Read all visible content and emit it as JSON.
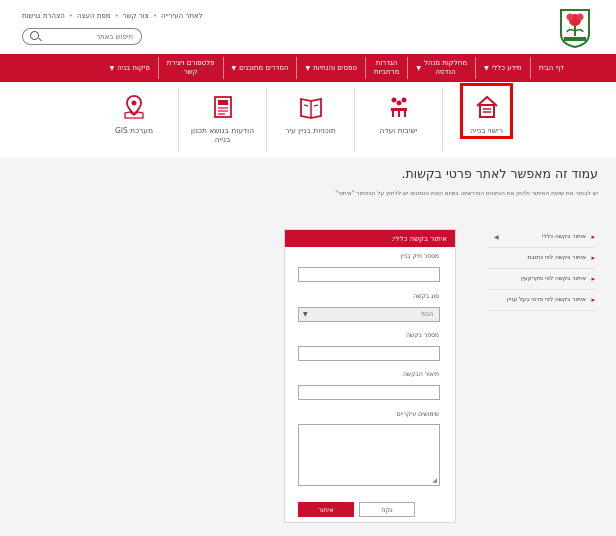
{
  "header": {
    "links": [
      "לאתר העירייה",
      "צור קשר",
      "מפת העצה",
      "הצהרת נגישות"
    ],
    "search_placeholder": "חיפוש באתר"
  },
  "nav": [
    {
      "label": "דף הבית",
      "caret": false
    },
    {
      "label": "מידע כללי",
      "caret": true
    },
    {
      "label": "מחלקות מנהל\nהנדסה",
      "caret": true
    },
    {
      "label": "הגדרות\nמרחביות",
      "caret": false
    },
    {
      "label": "טפסים והנחיות",
      "caret": true
    },
    {
      "label": "הסדרים מתוכנים",
      "caret": true
    },
    {
      "label": "פלטפורם ויצירת\nקשר",
      "caret": false
    },
    {
      "label": "פיקוח בניה",
      "caret": true
    }
  ],
  "icons": [
    {
      "label": "רישוי בנייה",
      "icon": "house-document-icon"
    },
    {
      "label": "ישיבות ועדה",
      "icon": "committee-people-icon"
    },
    {
      "label": "תוכניות בניין עיר",
      "icon": "map-book-icon"
    },
    {
      "label": "הודעות בנושא תכנון\nבנייה",
      "icon": "newspaper-icon"
    },
    {
      "label": "מערכת GIS",
      "icon": "map-pin-icon"
    }
  ],
  "page": {
    "title": "עמוד זה מאפשר לאתר פרטי בקשות.",
    "description": "יש לבחור את שיטת האיתור ולהזין את הנתונים הנדרשים. בסיום הזנת הנתונים יש ללחוץ על הכפתור \"איתור\""
  },
  "side_menu": [
    {
      "label": "איתור בקשה כללי",
      "arrow": true
    },
    {
      "label": "איתור בקשה לפי כתובת",
      "arrow": false
    },
    {
      "label": "איתור בקשה לפי מקרקעין",
      "arrow": false
    },
    {
      "label": "איתור בקשה לפי פרטי בעל עניין",
      "arrow": false
    }
  ],
  "form": {
    "header": "איתור בקשה כללי:",
    "file_number_label": "מספר תיק בניין",
    "request_type_label": "סוג בקשה",
    "request_type_value": "הכול",
    "request_number_label": "מספר בקשה",
    "request_description_label": "תיאור הבקשה",
    "main_uses_label": "שימושים עיקריים",
    "search_button": "איתור",
    "clear_button": "נקה"
  },
  "colors": {
    "brand_red": "#c8102e",
    "highlight_red": "#ee0000"
  }
}
